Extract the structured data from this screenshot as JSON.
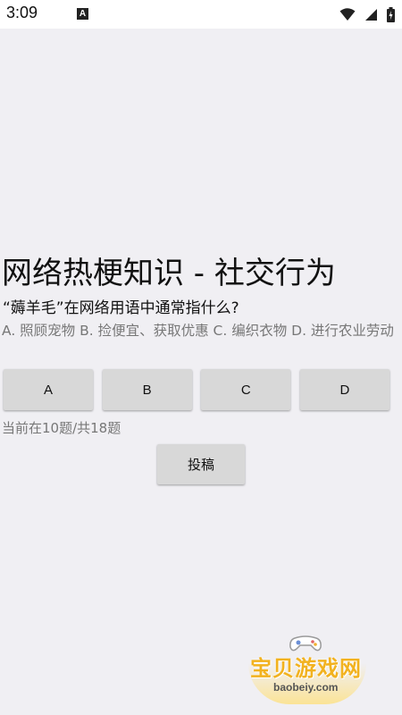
{
  "status_bar": {
    "time": "3:09",
    "notification_icon": "A"
  },
  "quiz": {
    "title": "网络热梗知识 - 社交行为",
    "question": "“薅羊毛”在网络用语中通常指什么?",
    "options_text": "A. 照顾宠物  B. 捡便宜、获取优惠  C. 编织衣物  D. 进行农业劳动",
    "answers": [
      "A",
      "B",
      "C",
      "D"
    ],
    "progress": "当前在10题/共18题",
    "submit_label": "投稿"
  },
  "watermark": {
    "name": "宝贝游戏网",
    "url": "baobeiy.com"
  },
  "colors": {
    "background": "#f0eff3",
    "button": "#d8d8d8",
    "watermark": "#f2b21f"
  }
}
